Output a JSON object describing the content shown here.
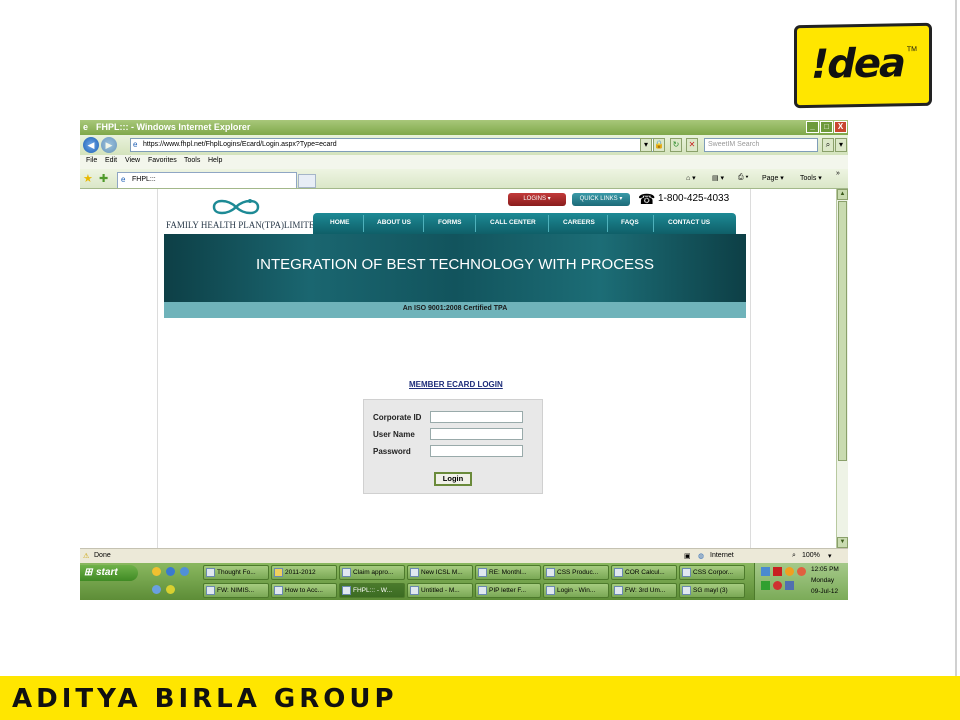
{
  "slide": {
    "logo_text": "!dea",
    "logo_tm": "TM",
    "footer": "ADITYA BIRLA GROUP",
    "accent_color": "#ffe600"
  },
  "window": {
    "title": "FHPL::: - Windows Internet Explorer",
    "buttons": {
      "minimize": "_",
      "maximize": "□",
      "close": "X"
    }
  },
  "address_bar": {
    "url": "https://www.fhpl.net/FhplLogins/Ecard/Login.aspx?Type=ecard",
    "search_placeholder": "SweetIM Search"
  },
  "menu": [
    "File",
    "Edit",
    "View",
    "Favorites",
    "Tools",
    "Help"
  ],
  "tabs": {
    "active_label": "FHPL:::"
  },
  "command_bar": {
    "page": "Page ▾",
    "tools": "Tools ▾"
  },
  "site": {
    "company_name": "FAMILY HEALTH PLAN(TPA)LIMITED",
    "logins_button": "LOGINS",
    "quicklinks_button": "QUICK LINKS",
    "phone": "1-800-425-4033",
    "nav": [
      "HOME",
      "ABOUT US",
      "FORMS",
      "CALL CENTER",
      "CAREERS",
      "FAQS",
      "CONTACT US"
    ],
    "banner_headline": "INTEGRATION OF BEST TECHNOLOGY WITH PROCESS",
    "iso_text": "An ISO 9001:2008 Certified TPA",
    "brand_teal": "#1d8a95"
  },
  "login_form": {
    "heading": "MEMBER ECARD LOGIN",
    "fields": [
      {
        "label": "Corporate ID",
        "value": ""
      },
      {
        "label": "User Name",
        "value": ""
      },
      {
        "label": "Password",
        "value": ""
      }
    ],
    "submit_label": "Login"
  },
  "status_bar": {
    "status": "Done",
    "zone": "Internet",
    "zoom": "100%"
  },
  "taskbar": {
    "start_label": "start",
    "row1": [
      "Thought Fo...",
      "2011-2012",
      "Claim appro...",
      "New ICSL M...",
      "RE: Monthl...",
      "CSS Produc...",
      "COR Calcul...",
      "CSS Corpor..."
    ],
    "row2": [
      "FW: NIMIS...",
      "How to Acc...",
      "FHPL::: - W...",
      "Untitled - M...",
      "PIP letter F...",
      "Login - Win...",
      "FW: 3rd Um...",
      "SG mayl (3)"
    ],
    "active_index_row2": 2,
    "clock": {
      "time": "12:05 PM",
      "day": "Monday",
      "date": "09-Jul-12"
    }
  }
}
